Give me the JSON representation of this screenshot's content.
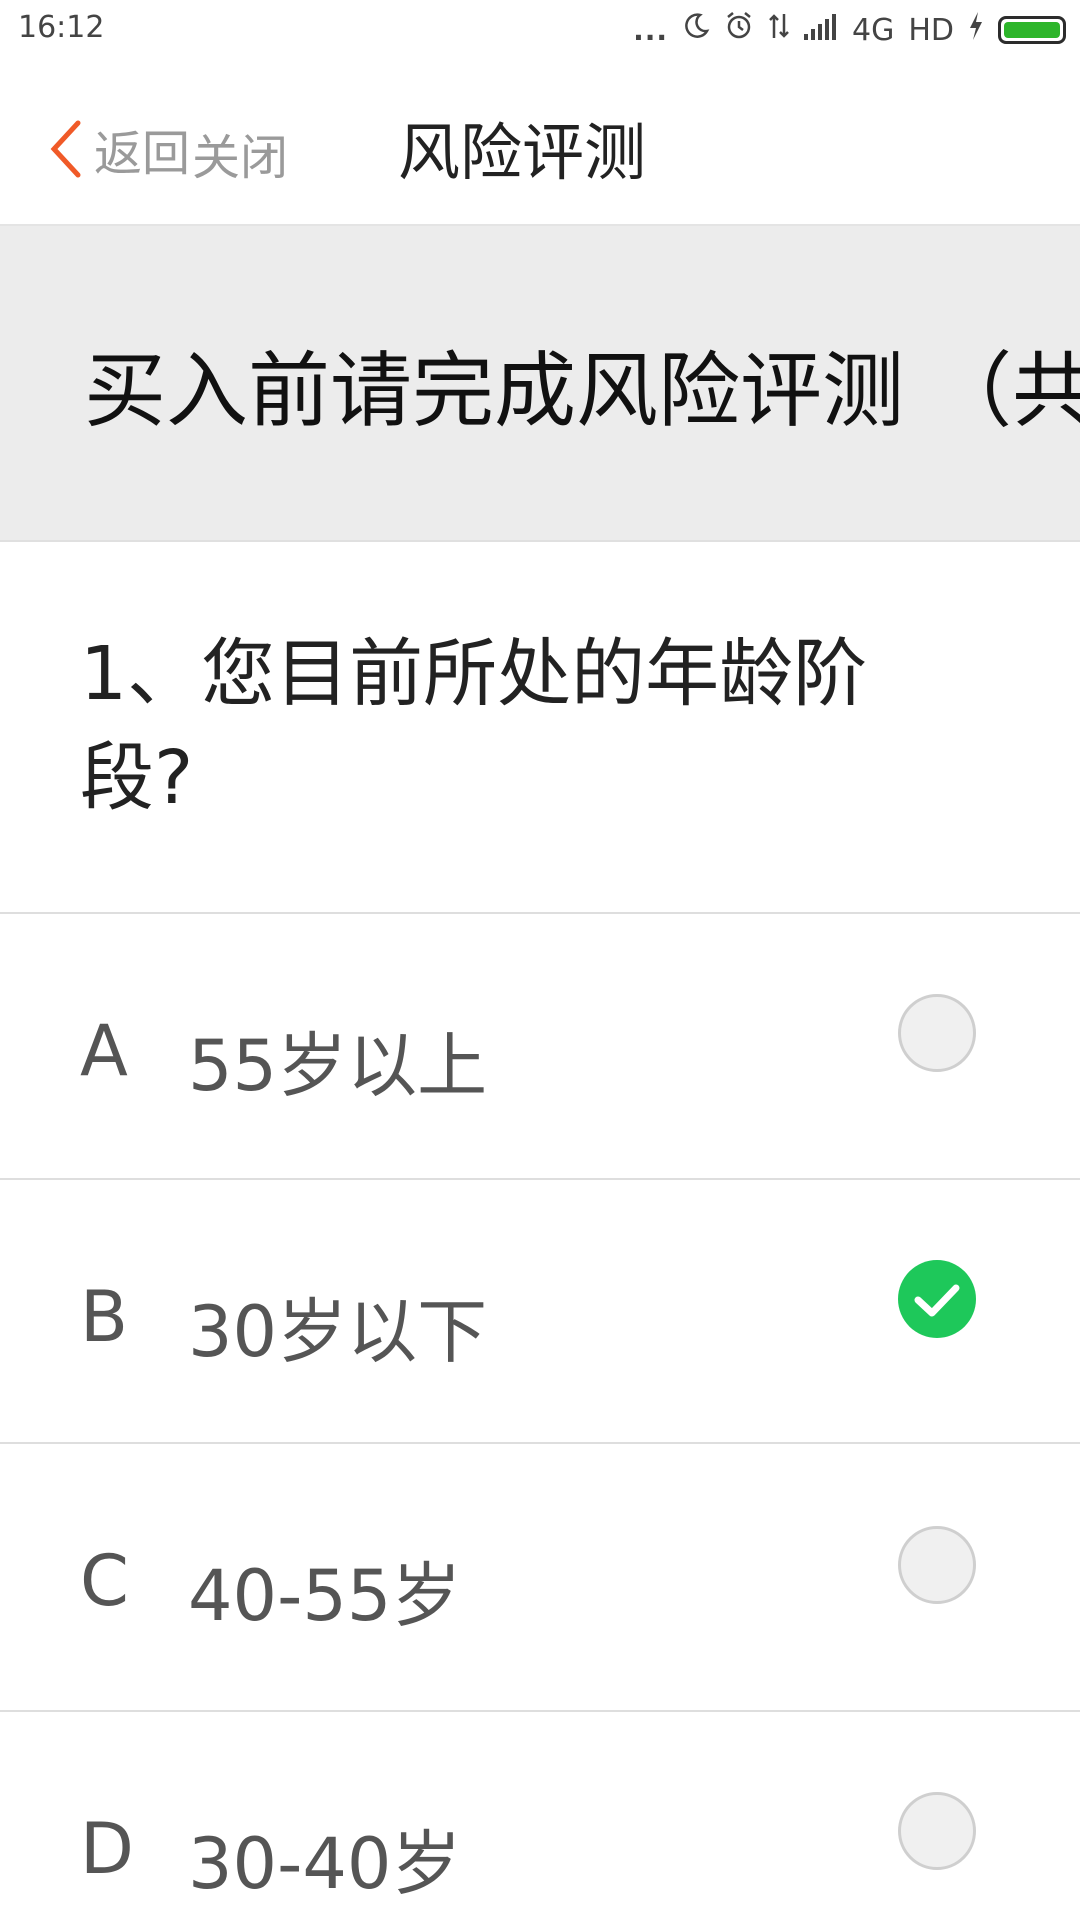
{
  "status_bar": {
    "time": "16:12",
    "dots": "...",
    "network": "4G",
    "hd": "HD",
    "battery_color": "#2db52a"
  },
  "nav": {
    "back_label": "返回",
    "close_label": "关闭",
    "title": "风险评测",
    "accent_color": "#f05a28"
  },
  "banner": {
    "text": "买入前请完成风险评测 （共"
  },
  "question": {
    "text": "1、您目前所处的年龄阶段?"
  },
  "options": [
    {
      "letter": "A",
      "text": "55岁以上",
      "selected": false
    },
    {
      "letter": "B",
      "text": "30岁以下",
      "selected": true
    },
    {
      "letter": "C",
      "text": "40-55岁",
      "selected": false
    },
    {
      "letter": "D",
      "text": "30-40岁",
      "selected": false
    }
  ],
  "colors": {
    "selected_radio": "#1ec85a",
    "divider": "#dedede",
    "banner_bg": "#ececec"
  }
}
